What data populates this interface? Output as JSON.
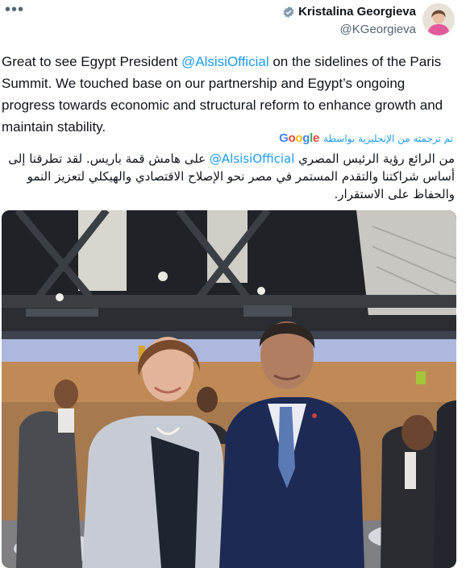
{
  "more_label": "•••",
  "author": {
    "name": "Kristalina Georgieva",
    "handle": "@KGeorgieva"
  },
  "tweet": {
    "text_part1": "Great to see Egypt President ",
    "mention": "@AlsisiOfficial",
    "text_part2": " on the sidelines of the Paris Summit. We touched base on our partnership and Egypt’s ongoing progress towards economic and structural reform to enhance growth and maintain stability."
  },
  "translation": {
    "label": "تم ترجمته من الإنجليزية بواسطة",
    "provider_letters": [
      "G",
      "o",
      "o",
      "g",
      "l",
      "e"
    ],
    "provider_colors": [
      "#4285F4",
      "#EA4335",
      "#FBBC05",
      "#4285F4",
      "#34A853",
      "#EA4335"
    ],
    "text_part1": "من الرائع رؤية الرئيس المصري ",
    "mention": "@AlsisiOfficial",
    "text_part2": " على هامش قمة باريس. لقد تطرقنا إلى أساس شراكتنا والتقدم المستمر في مصر نحو الإصلاح الاقتصادي والهيكلي لتعزيز النمو والحفاظ على الاستقرار."
  },
  "colors": {
    "link": "#1d9bf0",
    "verified": "#829aab",
    "text": "#0f1419",
    "secondary": "#536471"
  }
}
